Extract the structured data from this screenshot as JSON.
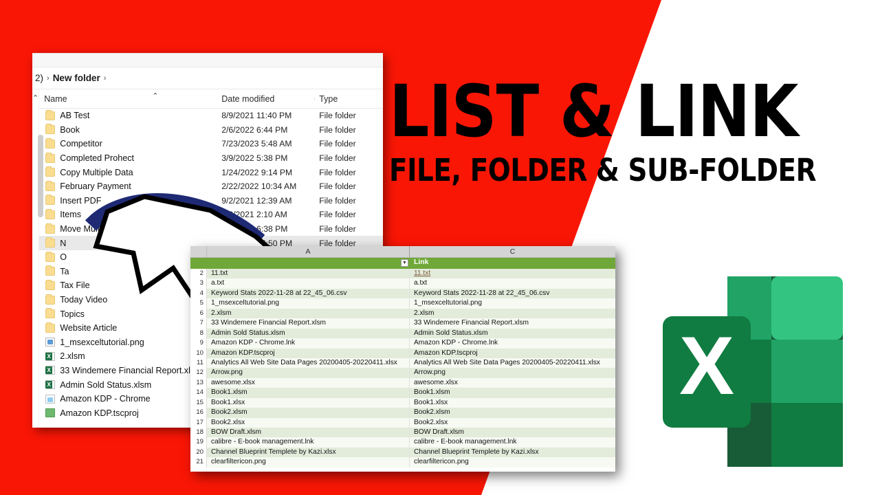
{
  "thumbnail": {
    "title_line1": "LIST & LINK",
    "title_line2": "FILE, FOLDER & SUB-FOLDER",
    "accent_red": "#FA1605",
    "accent_green": "#6FA838",
    "excel_logo_green": "#1E7145"
  },
  "explorer": {
    "breadcrumb": {
      "first": "2)",
      "sep1": "›",
      "folder": "New folder",
      "sep2": "›"
    },
    "columns": [
      "Name",
      "Date modified",
      "Type"
    ],
    "sort_indicator": "⌃",
    "rows": [
      {
        "name": "AB Test",
        "icon": "folder-icon",
        "date": "8/9/2021 11:40 PM",
        "type": "File folder"
      },
      {
        "name": "Book",
        "icon": "folder-icon",
        "date": "2/6/2022 6:44 PM",
        "type": "File folder"
      },
      {
        "name": "Competitor",
        "icon": "folder-icon",
        "date": "7/23/2023 5:48 AM",
        "type": "File folder"
      },
      {
        "name": "Completed Prohect",
        "icon": "folder-icon",
        "date": "3/9/2022 5:38 PM",
        "type": "File folder"
      },
      {
        "name": "Copy Multiple Data",
        "icon": "folder-icon",
        "date": "1/24/2022 9:14 PM",
        "type": "File folder"
      },
      {
        "name": "February Payment",
        "icon": "folder-icon",
        "date": "2/22/2022 10:34 AM",
        "type": "File folder"
      },
      {
        "name": "Insert PDF",
        "icon": "folder-icon",
        "date": "9/2/2021 12:39 AM",
        "type": "File folder"
      },
      {
        "name": "Items",
        "icon": "folder-icon",
        "date": "8/8/2021 2:10 AM",
        "type": "File folder"
      },
      {
        "name": "Move Multiple Da",
        "icon": "folder-icon",
        "date": "2/9/2022 6:38 PM",
        "type": "File folder"
      },
      {
        "name": "N",
        "icon": "folder-icon",
        "date": "9/23/2021 5:50 PM",
        "type": "File folder"
      },
      {
        "name": "O",
        "icon": "folder-icon",
        "date": "",
        "type": ""
      },
      {
        "name": "Ta",
        "icon": "folder-icon",
        "date": "",
        "type": ""
      },
      {
        "name": "Tax File",
        "icon": "folder-icon",
        "date": "",
        "type": ""
      },
      {
        "name": "Today Video",
        "icon": "folder-icon",
        "date": "",
        "type": ""
      },
      {
        "name": "Topics",
        "icon": "folder-icon",
        "date": "",
        "type": ""
      },
      {
        "name": "Website Article",
        "icon": "folder-icon",
        "date": "",
        "type": ""
      },
      {
        "name": "1_msexceltutorial.png",
        "icon": "image-file-icon",
        "date": "",
        "type": ""
      },
      {
        "name": "2.xlsm",
        "icon": "excel-file-icon",
        "date": "",
        "type": ""
      },
      {
        "name": "33 Windemere Financial Report.xls",
        "icon": "excel-file-icon",
        "date": "",
        "type": ""
      },
      {
        "name": "Admin Sold Status.xlsm",
        "icon": "excel-file-icon",
        "date": "",
        "type": ""
      },
      {
        "name": "Amazon KDP - Chrome",
        "icon": "shortcut-icon",
        "date": "",
        "type": ""
      },
      {
        "name": "Amazon KDP.tscproj",
        "icon": "camtasia-icon",
        "date": "",
        "type": ""
      }
    ]
  },
  "excel": {
    "column_letters": {
      "a": "A",
      "c": "C"
    },
    "header": {
      "a": "",
      "c": "Link"
    },
    "filter_glyph": "▼",
    "rows": [
      {
        "n": "2",
        "a": "11.txt",
        "c": "11.txt",
        "link": true
      },
      {
        "n": "3",
        "a": "a.txt",
        "c": "a.txt",
        "link": false
      },
      {
        "n": "4",
        "a": "Keyword Stats 2022-11-28 at 22_45_06.csv",
        "c": "Keyword Stats 2022-11-28 at 22_45_06.csv",
        "link": false
      },
      {
        "n": "5",
        "a": "1_msexceltutorial.png",
        "c": "1_msexceltutorial.png",
        "link": false
      },
      {
        "n": "6",
        "a": "2.xlsm",
        "c": "2.xlsm",
        "link": false
      },
      {
        "n": "7",
        "a": "33 Windemere Financial Report.xlsm",
        "c": "33 Windemere Financial Report.xlsm",
        "link": false
      },
      {
        "n": "8",
        "a": "Admin Sold Status.xlsm",
        "c": "Admin Sold Status.xlsm",
        "link": false
      },
      {
        "n": "9",
        "a": "Amazon KDP - Chrome.lnk",
        "c": "Amazon KDP - Chrome.lnk",
        "link": false
      },
      {
        "n": "10",
        "a": "Amazon KDP.tscproj",
        "c": "Amazon KDP.tscproj",
        "link": false
      },
      {
        "n": "11",
        "a": "Analytics All Web Site Data Pages 20200405-20220411.xlsx",
        "c": "Analytics All Web Site Data Pages 20200405-20220411.xlsx",
        "link": false
      },
      {
        "n": "12",
        "a": "Arrow.png",
        "c": "Arrow.png",
        "link": false
      },
      {
        "n": "13",
        "a": "awesome.xlsx",
        "c": "awesome.xlsx",
        "link": false
      },
      {
        "n": "14",
        "a": "Book1.xlsm",
        "c": "Book1.xlsm",
        "link": false
      },
      {
        "n": "15",
        "a": "Book1.xlsx",
        "c": "Book1.xlsx",
        "link": false
      },
      {
        "n": "16",
        "a": "Book2.xlsm",
        "c": "Book2.xlsm",
        "link": false
      },
      {
        "n": "17",
        "a": "Book2.xlsx",
        "c": "Book2.xlsx",
        "link": false
      },
      {
        "n": "18",
        "a": "BOW Draft.xlsm",
        "c": "BOW Draft.xlsm",
        "link": false
      },
      {
        "n": "19",
        "a": "calibre - E-book management.lnk",
        "c": "calibre - E-book management.lnk",
        "link": false
      },
      {
        "n": "20",
        "a": "Channel Blueprint Templete by Kazi.xlsx",
        "c": "Channel Blueprint Templete by Kazi.xlsx",
        "link": false
      },
      {
        "n": "21",
        "a": "clearfiltericon.png",
        "c": "clearfiltericon.png",
        "link": false
      }
    ]
  },
  "excel_logo": {
    "letter": "X"
  }
}
